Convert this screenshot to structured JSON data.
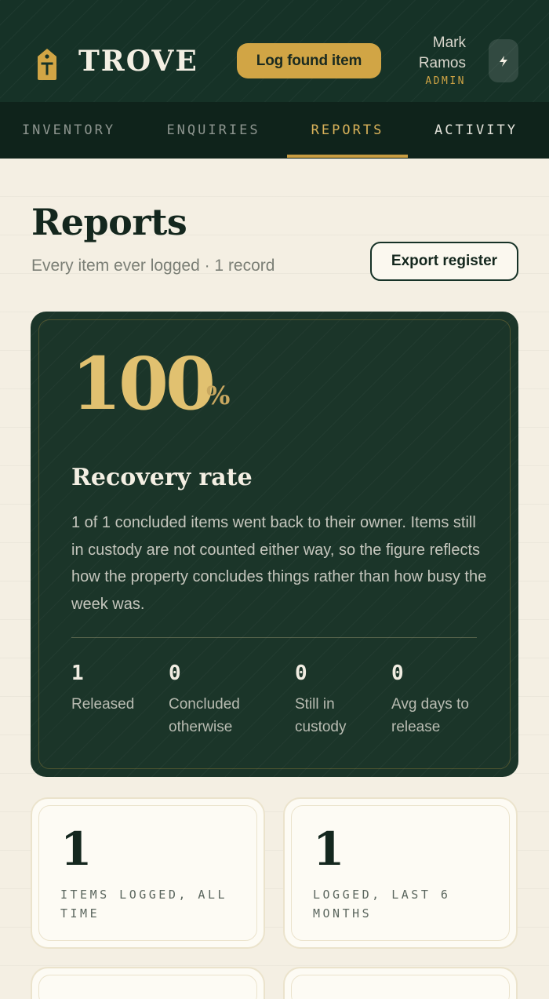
{
  "header": {
    "brand": "TROVE",
    "log_button": "Log found item",
    "user": {
      "first_name": "Mark",
      "last_name": "Ramos",
      "role": "ADMIN"
    },
    "quick_icon": "bolt-icon"
  },
  "nav": {
    "tabs": [
      {
        "label": "INVENTORY",
        "active": false
      },
      {
        "label": "ENQUIRIES",
        "active": false
      },
      {
        "label": "REPORTS",
        "active": true
      },
      {
        "label": "ACTIVITY",
        "active": false
      }
    ]
  },
  "page": {
    "title": "Reports",
    "subtitle": "Every item ever logged · 1 record",
    "export_button": "Export register"
  },
  "recovery": {
    "value": "100",
    "unit": "%",
    "title": "Recovery rate",
    "description": "1 of 1 concluded items went back to their owner. Items still in custody are not counted either way, so the figure reflects how the property concludes things rather than how busy the week was.",
    "stats": [
      {
        "value": "1",
        "label": "Released"
      },
      {
        "value": "0",
        "label": "Concluded otherwise"
      },
      {
        "value": "0",
        "label": "Still in custody"
      },
      {
        "value": "0",
        "label": "Avg days to release"
      }
    ]
  },
  "cards": [
    {
      "value": "1",
      "label": "ITEMS LOGGED, ALL TIME"
    },
    {
      "value": "1",
      "label": "LOGGED, LAST 6 MONTHS"
    }
  ],
  "colors": {
    "header_bg": "#163227",
    "nav_bg": "#0f231b",
    "accent_gold": "#d1a545",
    "page_bg": "#f4efe3",
    "hero_bg": "#1b3529"
  }
}
